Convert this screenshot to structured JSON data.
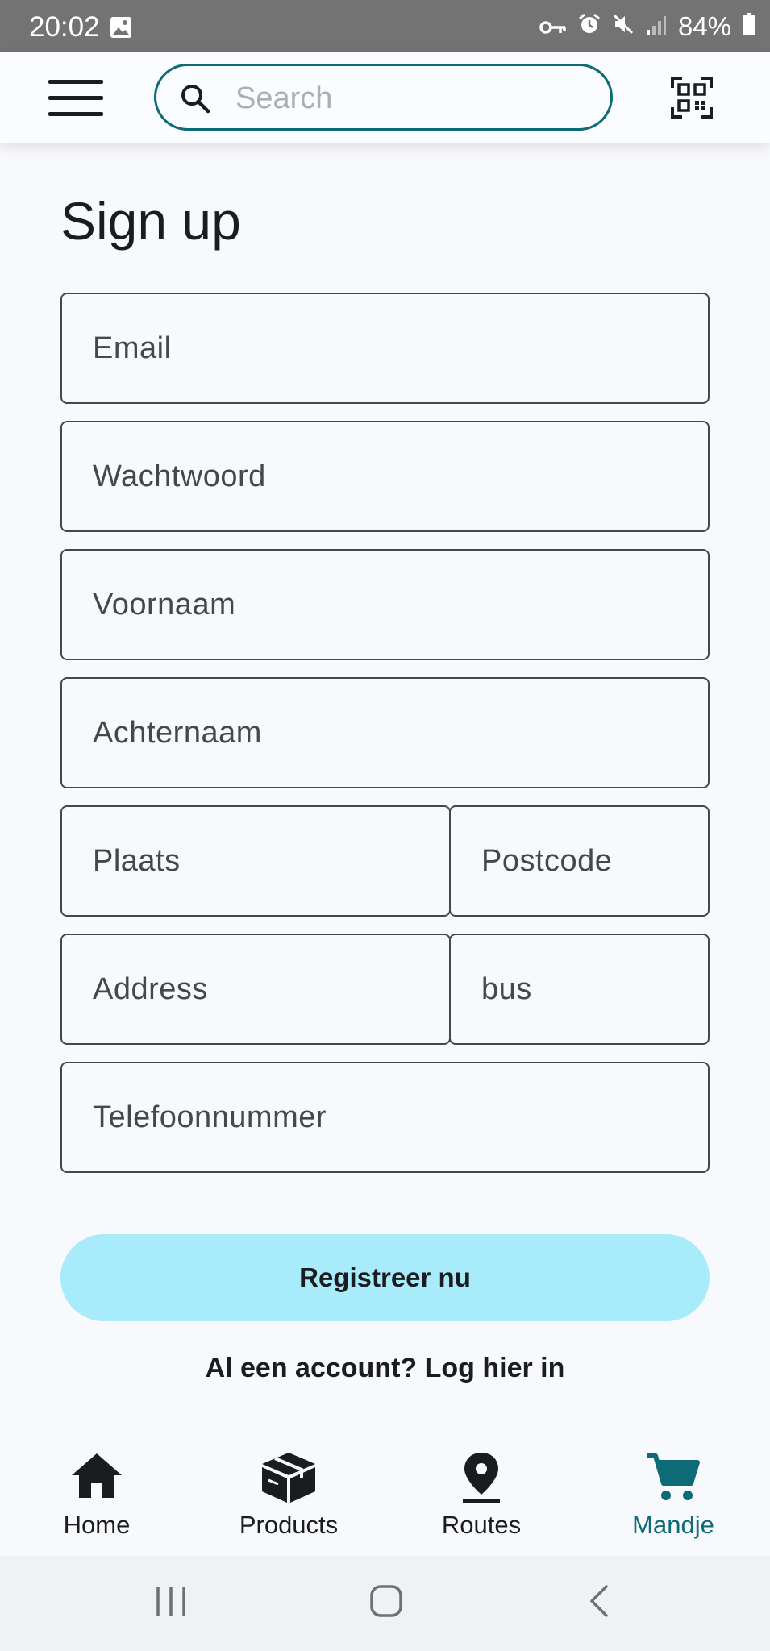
{
  "status_bar": {
    "time": "20:02",
    "battery": "84%",
    "icons": [
      "gallery-icon",
      "key-icon",
      "alarm-icon",
      "mute-icon",
      "signal-icon",
      "battery-icon"
    ]
  },
  "app_bar": {
    "menu_icon": "hamburger-icon",
    "search": {
      "placeholder": "Search",
      "value": ""
    },
    "qr_icon": "qr-scan-icon"
  },
  "form": {
    "title": "Sign up",
    "fields": {
      "email": "Email",
      "password": "Wachtwoord",
      "first_name": "Voornaam",
      "last_name": "Achternaam",
      "city": "Plaats",
      "postcode": "Postcode",
      "address": "Address",
      "bus": "bus",
      "phone": "Telefoonnummer"
    },
    "submit_label": "Registreer nu",
    "login_link": "Al een account? Log hier in"
  },
  "bottom_nav": {
    "items": [
      {
        "label": "Home",
        "icon": "home-icon",
        "active": false
      },
      {
        "label": "Products",
        "icon": "package-icon",
        "active": false
      },
      {
        "label": "Routes",
        "icon": "location-pin-icon",
        "active": false
      },
      {
        "label": "Mandje",
        "icon": "cart-icon",
        "active": true
      }
    ]
  },
  "colors": {
    "accent": "#0c6b77",
    "button_bg": "#a8ebfb",
    "status_bar": "#737373"
  },
  "system_nav": [
    "recents-icon",
    "home-circle-icon",
    "back-icon"
  ]
}
